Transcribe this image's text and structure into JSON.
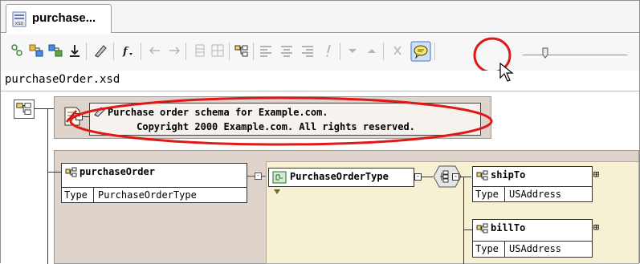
{
  "tab": {
    "label": "purchase...",
    "icon": "xsd-file-icon",
    "icon_text": "XSD"
  },
  "toolbar": {
    "buttons": [
      "schema-view-icon",
      "expand-icon",
      "collapse-icon",
      "down-arrow-icon",
      "edit-icon",
      "function-icon",
      "back-arrow-icon",
      "forward-arrow-icon",
      "grid-icon",
      "table-icon",
      "tree-icon",
      "align-left-icon",
      "align-center-icon",
      "align-right-icon",
      "exclamation-icon",
      "down-icon",
      "up-icon",
      "delete-icon",
      "annotation-toggle-icon"
    ],
    "highlighted_button": "annotation-toggle-icon"
  },
  "path": {
    "text": "purchaseOrder.xsd"
  },
  "annotation": {
    "line1": "Purchase order schema for Example.com.",
    "line2": "     Copyright 2000 Example.com. All rights reserved."
  },
  "elements": {
    "purchase_order": {
      "name": "purchaseOrder",
      "type_label": "Type",
      "type_value": "PurchaseOrderType"
    },
    "complex_type": {
      "name": "PurchaseOrderType"
    },
    "ship_to": {
      "name": "shipTo",
      "type_label": "Type",
      "type_value": "USAddress"
    },
    "bill_to": {
      "name": "billTo",
      "type_label": "Type",
      "type_value": "USAddress"
    }
  },
  "colors": {
    "highlight_red": "#e01818",
    "panel": "#ded4cc",
    "inner_panel": "#f7f1d4",
    "connector_blue": "#3a4fb4"
  }
}
